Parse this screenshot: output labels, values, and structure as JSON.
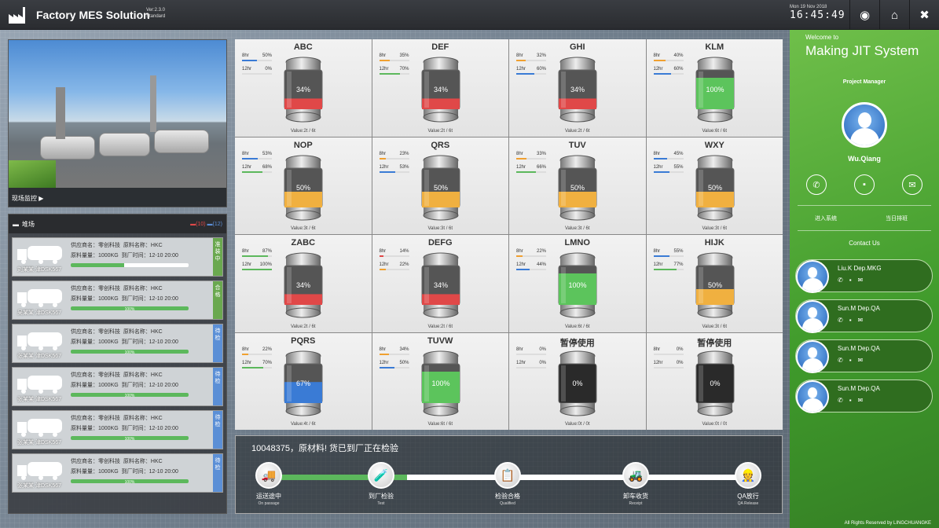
{
  "app": {
    "title": "Factory MES Solution",
    "version": "Ver:2.3.0",
    "edition": "Standard",
    "date": "Mon 19 Nov 2018",
    "time": "16:45:49"
  },
  "camera": {
    "label": "现场监控 ▶"
  },
  "yard": {
    "title": "堆场",
    "count_red": "(10)",
    "count_blue": "(12)",
    "trucks": [
      {
        "driver": "刘某某 津DSK567",
        "supplier": "供应商名：零创科技",
        "material": "原料名称：HKC",
        "qty": "原料量量：1000KG",
        "time": "到厂时间：12-10 20:00",
        "progress": 45,
        "progress_label": "45%",
        "status": "准装中",
        "status_color": "#6aa84f"
      },
      {
        "driver": "吴某某 津DSK567",
        "supplier": "供应商名：零创科技",
        "material": "原料名称：HKC",
        "qty": "原料量量：1000KG",
        "time": "到厂时间：12-10 20:00",
        "progress": 100,
        "progress_label": "100%",
        "status": "合格",
        "status_color": "#6aa84f"
      },
      {
        "driver": "张某某 津DSK567",
        "supplier": "供应商名：零创科技",
        "material": "原料名称：HKC",
        "qty": "原料量量：1000KG",
        "time": "到厂时间：12-10 20:00",
        "progress": 100,
        "progress_label": "100%",
        "status": "待检",
        "status_color": "#5b8fd6"
      },
      {
        "driver": "张某某 津DSK567",
        "supplier": "供应商名：零创科技",
        "material": "原料名称：HKC",
        "qty": "原料量量：1000KG",
        "time": "到厂时间：12-10 20:00",
        "progress": 100,
        "progress_label": "100%",
        "status": "待检",
        "status_color": "#5b8fd6"
      },
      {
        "driver": "张某某 津DSK567",
        "supplier": "供应商名：零创科技",
        "material": "原料名称：HKC",
        "qty": "原料量量：1000KG",
        "time": "到厂时间：12-10 20:00",
        "progress": 100,
        "progress_label": "100%",
        "status": "待检",
        "status_color": "#5b8fd6"
      },
      {
        "driver": "张某某 津DSK567",
        "supplier": "供应商名：零创科技",
        "material": "原料名称：HKC",
        "qty": "原料量量：1000KG",
        "time": "到厂时间：12-10 20:00",
        "progress": 100,
        "progress_label": "100%",
        "status": "待检",
        "status_color": "#5b8fd6"
      }
    ]
  },
  "tanks": [
    {
      "name": "ABC",
      "h8": "50%",
      "h12": "0%",
      "l8": 50,
      "l12": 0,
      "c8": "#3a7bd5",
      "c12": "#5cb85c",
      "fill": 34,
      "label": "34%",
      "color": "#e04848",
      "value": "Value:2t / 6t"
    },
    {
      "name": "DEF",
      "h8": "35%",
      "h12": "70%",
      "l8": 35,
      "l12": 70,
      "c8": "#f0a030",
      "c12": "#5cb85c",
      "fill": 34,
      "label": "34%",
      "color": "#e04848",
      "value": "Value:2t / 6t"
    },
    {
      "name": "GHI",
      "h8": "32%",
      "h12": "60%",
      "l8": 32,
      "l12": 60,
      "c8": "#f0a030",
      "c12": "#3a7bd5",
      "fill": 34,
      "label": "34%",
      "color": "#e04848",
      "value": "Value:2t / 6t"
    },
    {
      "name": "KLM",
      "h8": "40%",
      "h12": "60%",
      "l8": 40,
      "l12": 60,
      "c8": "#f0a030",
      "c12": "#3a7bd5",
      "fill": 100,
      "label": "100%",
      "color": "#5cc45c",
      "value": "Value:6t / 6t"
    },
    {
      "name": "NOP",
      "h8": "53%",
      "h12": "68%",
      "l8": 53,
      "l12": 68,
      "c8": "#3a7bd5",
      "c12": "#5cb85c",
      "fill": 50,
      "label": "50%",
      "color": "#f0b040",
      "value": "Value:3t / 6t"
    },
    {
      "name": "QRS",
      "h8": "23%",
      "h12": "53%",
      "l8": 23,
      "l12": 53,
      "c8": "#f0a030",
      "c12": "#3a7bd5",
      "fill": 50,
      "label": "50%",
      "color": "#f0b040",
      "value": "Value:3t / 6t"
    },
    {
      "name": "TUV",
      "h8": "33%",
      "h12": "66%",
      "l8": 33,
      "l12": 66,
      "c8": "#f0a030",
      "c12": "#5cb85c",
      "fill": 50,
      "label": "50%",
      "color": "#f0b040",
      "value": "Value:3t / 6t"
    },
    {
      "name": "WXY",
      "h8": "45%",
      "h12": "55%",
      "l8": 45,
      "l12": 55,
      "c8": "#3a7bd5",
      "c12": "#3a7bd5",
      "fill": 50,
      "label": "50%",
      "color": "#f0b040",
      "value": "Value:3t / 6t"
    },
    {
      "name": "ZABC",
      "h8": "87%",
      "h12": "100%",
      "l8": 87,
      "l12": 100,
      "c8": "#5cb85c",
      "c12": "#5cb85c",
      "fill": 34,
      "label": "34%",
      "color": "#e04848",
      "value": "Value:2t / 6t"
    },
    {
      "name": "DEFG",
      "h8": "14%",
      "h12": "22%",
      "l8": 14,
      "l12": 22,
      "c8": "#e04848",
      "c12": "#f0a030",
      "fill": 34,
      "label": "34%",
      "color": "#e04848",
      "value": "Value:2t / 6t"
    },
    {
      "name": "LMNO",
      "h8": "22%",
      "h12": "44%",
      "l8": 22,
      "l12": 44,
      "c8": "#f0a030",
      "c12": "#3a7bd5",
      "fill": 100,
      "label": "100%",
      "color": "#5cc45c",
      "value": "Value:6t / 6t"
    },
    {
      "name": "HIJK",
      "h8": "55%",
      "h12": "77%",
      "l8": 55,
      "l12": 77,
      "c8": "#3a7bd5",
      "c12": "#5cb85c",
      "fill": 50,
      "label": "50%",
      "color": "#f0b040",
      "value": "Value:3t / 6t"
    },
    {
      "name": "PQRS",
      "h8": "22%",
      "h12": "70%",
      "l8": 22,
      "l12": 70,
      "c8": "#f0a030",
      "c12": "#5cb85c",
      "fill": 67,
      "label": "67%",
      "color": "#3a7bd5",
      "value": "Value:4t / 6t"
    },
    {
      "name": "TUVW",
      "h8": "34%",
      "h12": "50%",
      "l8": 34,
      "l12": 50,
      "c8": "#f0a030",
      "c12": "#3a7bd5",
      "fill": 100,
      "label": "100%",
      "color": "#5cc45c",
      "value": "Value:6t / 6t"
    },
    {
      "name": "暂停使用",
      "h8": "0%",
      "h12": "0%",
      "l8": 0,
      "l12": 0,
      "c8": "#f0a030",
      "c12": "#3a7bd5",
      "fill": 0,
      "label": "0%",
      "color": "#333",
      "value": "Value:0t / 0t",
      "disabled": true
    },
    {
      "name": "暂停使用",
      "h8": "0%",
      "h12": "0%",
      "l8": 0,
      "l12": 0,
      "c8": "#f0a030",
      "c12": "#3a7bd5",
      "fill": 0,
      "label": "0%",
      "color": "#333",
      "value": "Value:0t / 0t",
      "disabled": true
    }
  ],
  "progress": {
    "message": "10048375，原材料! 货已到厂正在检验",
    "done": 29,
    "steps": [
      {
        "label": "运送途中",
        "sub": "On passage",
        "icon": "🚚"
      },
      {
        "label": "到厂检验",
        "sub": "Test",
        "icon": "🧪"
      },
      {
        "label": "检验合格",
        "sub": "Qualified",
        "icon": "📋"
      },
      {
        "label": "卸车收货",
        "sub": "Receipt",
        "icon": "🚜"
      },
      {
        "label": "QA放行",
        "sub": "QA Release",
        "icon": "👷"
      }
    ]
  },
  "user": {
    "welcome": "Welcome to",
    "system": "Making JIT System",
    "role": "Project Manager",
    "name": "Wu.Qiang",
    "link1": "进入系统",
    "link2": "当日排班",
    "contact_title": "Contact Us"
  },
  "contacts": [
    {
      "name": "Liu.K   Dep.MKG"
    },
    {
      "name": "Sun.M   Dep.QA"
    },
    {
      "name": "Sun.M   Dep.QA"
    },
    {
      "name": "Sun.M   Dep.QA"
    }
  ],
  "footer": "All Rights Reserved by LINGCHUANGKE"
}
